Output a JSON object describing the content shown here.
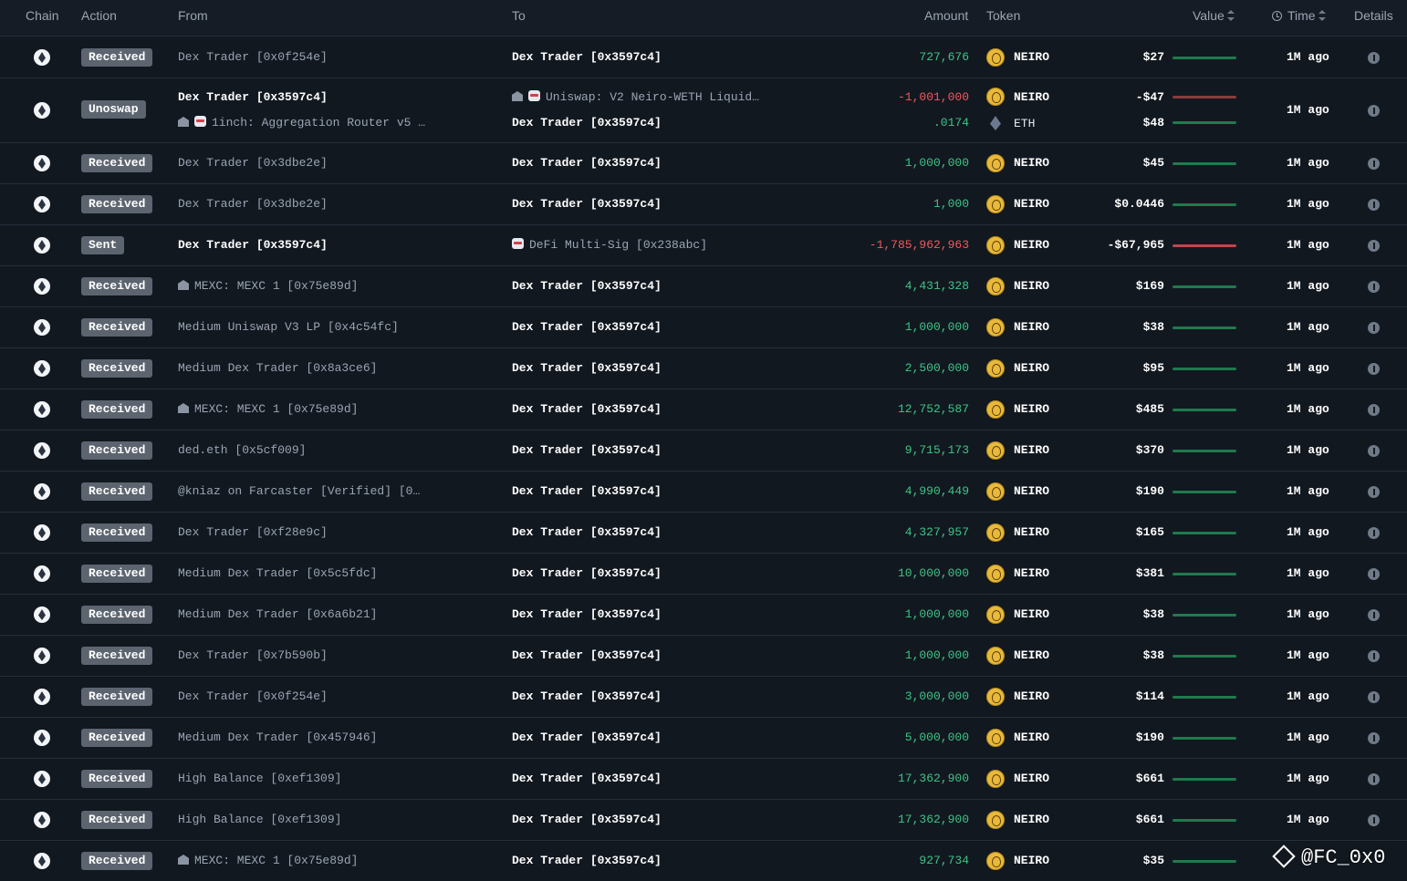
{
  "header": {
    "chain": "Chain",
    "action": "Action",
    "from": "From",
    "to": "To",
    "amount": "Amount",
    "token": "Token",
    "value": "Value",
    "time": "Time",
    "details": "Details"
  },
  "rows": [
    {
      "action": "Received",
      "from": "Dex Trader [0x0f254e]",
      "to": "Dex Trader [0x3597c4]",
      "amount": "727,676",
      "token": "NEIRO",
      "value": "$27",
      "time": "1M ago"
    },
    {
      "action": "Unoswap",
      "from": "Dex Trader [0x3597c4]",
      "from2": "1inch: Aggregation Router v5 …",
      "to": "Uniswap: V2 Neiro-WETH Liquid…",
      "to2": "Dex Trader [0x3597c4]",
      "amount": "-1,001,000",
      "amount2": ".0174",
      "token": "NEIRO",
      "token2": "ETH",
      "value": "-$47",
      "value2": "$48",
      "time": "1M ago"
    },
    {
      "action": "Received",
      "from": "Dex Trader [0x3dbe2e]",
      "to": "Dex Trader [0x3597c4]",
      "amount": "1,000,000",
      "token": "NEIRO",
      "value": "$45",
      "time": "1M ago"
    },
    {
      "action": "Received",
      "from": "Dex Trader [0x3dbe2e]",
      "to": "Dex Trader [0x3597c4]",
      "amount": "1,000",
      "token": "NEIRO",
      "value": "$0.0446",
      "time": "1M ago"
    },
    {
      "action": "Sent",
      "from": "Dex Trader [0x3597c4]",
      "to": "DeFi Multi-Sig [0x238abc]",
      "amount": "-1,785,962,963",
      "token": "NEIRO",
      "value": "-$67,965",
      "time": "1M ago"
    },
    {
      "action": "Received",
      "from": "MEXC: MEXC 1 [0x75e89d]",
      "to": "Dex Trader [0x3597c4]",
      "amount": "4,431,328",
      "token": "NEIRO",
      "value": "$169",
      "time": "1M ago"
    },
    {
      "action": "Received",
      "from": "Medium Uniswap V3 LP [0x4c54fc]",
      "to": "Dex Trader [0x3597c4]",
      "amount": "1,000,000",
      "token": "NEIRO",
      "value": "$38",
      "time": "1M ago"
    },
    {
      "action": "Received",
      "from": "Medium Dex Trader [0x8a3ce6]",
      "to": "Dex Trader [0x3597c4]",
      "amount": "2,500,000",
      "token": "NEIRO",
      "value": "$95",
      "time": "1M ago"
    },
    {
      "action": "Received",
      "from": "MEXC: MEXC 1 [0x75e89d]",
      "to": "Dex Trader [0x3597c4]",
      "amount": "12,752,587",
      "token": "NEIRO",
      "value": "$485",
      "time": "1M ago"
    },
    {
      "action": "Received",
      "from": "ded.eth [0x5cf009]",
      "to": "Dex Trader [0x3597c4]",
      "amount": "9,715,173",
      "token": "NEIRO",
      "value": "$370",
      "time": "1M ago"
    },
    {
      "action": "Received",
      "from": "@kniaz on Farcaster [Verified] [0…",
      "to": "Dex Trader [0x3597c4]",
      "amount": "4,990,449",
      "token": "NEIRO",
      "value": "$190",
      "time": "1M ago"
    },
    {
      "action": "Received",
      "from": "Dex Trader [0xf28e9c]",
      "to": "Dex Trader [0x3597c4]",
      "amount": "4,327,957",
      "token": "NEIRO",
      "value": "$165",
      "time": "1M ago"
    },
    {
      "action": "Received",
      "from": "Medium Dex Trader [0x5c5fdc]",
      "to": "Dex Trader [0x3597c4]",
      "amount": "10,000,000",
      "token": "NEIRO",
      "value": "$381",
      "time": "1M ago"
    },
    {
      "action": "Received",
      "from": "Medium Dex Trader [0x6a6b21]",
      "to": "Dex Trader [0x3597c4]",
      "amount": "1,000,000",
      "token": "NEIRO",
      "value": "$38",
      "time": "1M ago"
    },
    {
      "action": "Received",
      "from": "Dex Trader [0x7b590b]",
      "to": "Dex Trader [0x3597c4]",
      "amount": "1,000,000",
      "token": "NEIRO",
      "value": "$38",
      "time": "1M ago"
    },
    {
      "action": "Received",
      "from": "Dex Trader [0x0f254e]",
      "to": "Dex Trader [0x3597c4]",
      "amount": "3,000,000",
      "token": "NEIRO",
      "value": "$114",
      "time": "1M ago"
    },
    {
      "action": "Received",
      "from": "Medium Dex Trader [0x457946]",
      "to": "Dex Trader [0x3597c4]",
      "amount": "5,000,000",
      "token": "NEIRO",
      "value": "$190",
      "time": "1M ago"
    },
    {
      "action": "Received",
      "from": "High Balance [0xef1309]",
      "to": "Dex Trader [0x3597c4]",
      "amount": "17,362,900",
      "token": "NEIRO",
      "value": "$661",
      "time": "1M ago"
    },
    {
      "action": "Received",
      "from": "High Balance [0xef1309]",
      "to": "Dex Trader [0x3597c4]",
      "amount": "17,362,900",
      "token": "NEIRO",
      "value": "$661",
      "time": "1M ago"
    },
    {
      "action": "Received",
      "from": "MEXC: MEXC 1 [0x75e89d]",
      "to": "Dex Trader [0x3597c4]",
      "amount": "927,734",
      "token": "NEIRO",
      "value": "$35",
      "time": "1M ago"
    }
  ],
  "watermark": "@FC_0x0"
}
